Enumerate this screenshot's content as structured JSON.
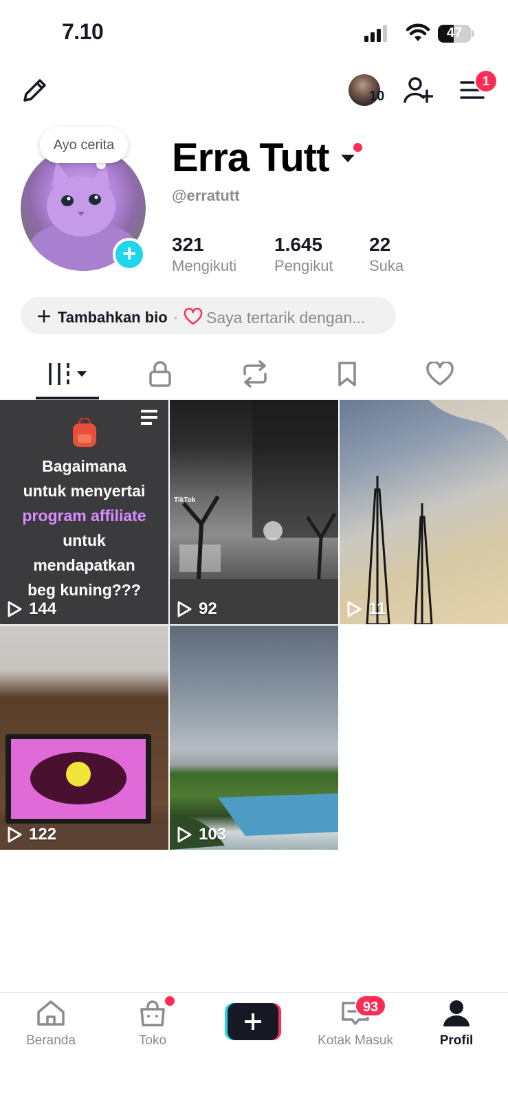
{
  "status_bar": {
    "time": "7.10",
    "battery": "47",
    "battery_level": 0.47
  },
  "header": {
    "friends_count": "10",
    "menu_badge": "1"
  },
  "profile": {
    "story_prompt": "Ayo cerita",
    "display_name": "Erra Tutt",
    "username": "@erratutt",
    "stats": [
      {
        "value": "321",
        "label": "Mengikuti"
      },
      {
        "value": "1.645",
        "label": "Pengikut"
      },
      {
        "value": "22",
        "label": "Suka"
      }
    ],
    "bio": {
      "add_label": "Tambahkan bio",
      "separator": "·",
      "interest_label": "Saya tertarik dengan..."
    }
  },
  "tabs": [
    {
      "name": "videos",
      "icon": "grid-icon",
      "active": true
    },
    {
      "name": "private",
      "icon": "lock-icon"
    },
    {
      "name": "reposts",
      "icon": "repost-icon"
    },
    {
      "name": "favorites",
      "icon": "bookmark-icon"
    },
    {
      "name": "liked",
      "icon": "heart-icon"
    }
  ],
  "videos": [
    {
      "views": "144",
      "caption": {
        "line1": "Bagaimana",
        "line2": "untuk menyertai",
        "highlight": "program affiliate",
        "line4": "untuk",
        "line5": "mendapatkan",
        "line6": "beg kuning???"
      }
    },
    {
      "views": "92",
      "watermark": "TikTok"
    },
    {
      "views": "11"
    },
    {
      "views": "122"
    },
    {
      "views": "103"
    }
  ],
  "bottom_nav": {
    "items": [
      {
        "label": "Beranda",
        "icon": "home-icon"
      },
      {
        "label": "Toko",
        "icon": "shop-bag-icon"
      },
      {
        "label": "",
        "icon": "create-plus-icon"
      },
      {
        "label": "Kotak Masuk",
        "icon": "inbox-icon",
        "badge": "93"
      },
      {
        "label": "Profil",
        "icon": "profile-icon",
        "active": true
      }
    ]
  },
  "colors": {
    "accent": "#fe2c55",
    "cyan": "#20d5ec",
    "text": "#161823",
    "muted": "#8a8b91"
  }
}
